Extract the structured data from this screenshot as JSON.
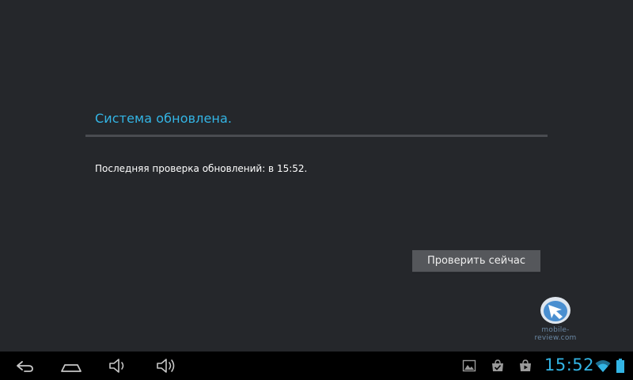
{
  "update_screen": {
    "title": "Система обновлена.",
    "last_check_text": "Последняя проверка обновлений: в 15:52.",
    "check_button_label": "Проверить сейчас"
  },
  "watermark": {
    "icon": "mobile-review-logo",
    "text": "mobile-review.com"
  },
  "navbar": {
    "buttons": [
      "back-icon",
      "home-icon",
      "volume-down-icon",
      "volume-up-icon"
    ],
    "notifications": [
      "gallery-notification-icon",
      "market-notification-icon",
      "play-store-notification-icon"
    ],
    "time": "15:52",
    "status_icons": [
      "wifi-icon",
      "battery-icon"
    ]
  },
  "colors": {
    "accent": "#33b5e5",
    "background": "#25272b",
    "navbar": "#000000"
  }
}
